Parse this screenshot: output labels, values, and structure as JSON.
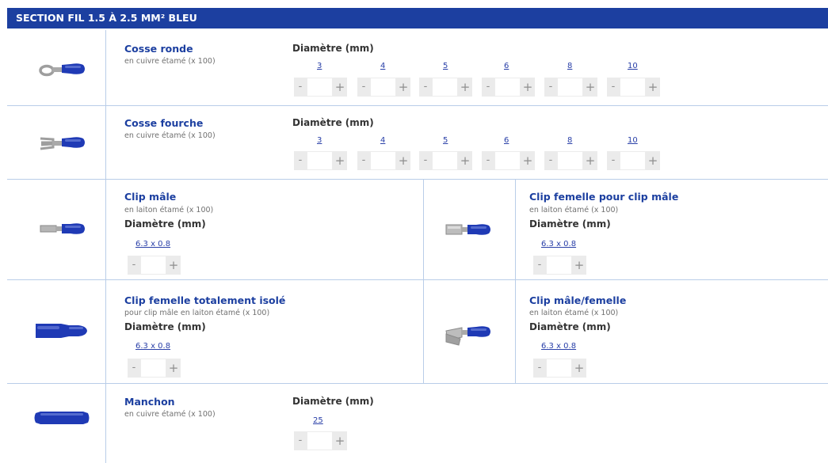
{
  "header": {
    "title": "SECTION FIL 1.5 À 2.5 MM² BLEU"
  },
  "diameter_label": "Diamètre (mm)",
  "stepper": {
    "minus": "-",
    "plus": "+"
  },
  "products": {
    "cosse_ronde": {
      "title": "Cosse ronde",
      "subtitle": "en cuivre étamé (x 100)",
      "sizes": [
        "3",
        "4",
        "5",
        "6",
        "8",
        "10"
      ]
    },
    "cosse_fourche": {
      "title": "Cosse fourche",
      "subtitle": "en cuivre étamé (x 100)",
      "sizes": [
        "3",
        "4",
        "5",
        "6",
        "8",
        "10"
      ]
    },
    "clip_male": {
      "title": "Clip mâle",
      "subtitle": "en laiton étamé (x 100)",
      "sizes": [
        "6.3 x 0.8"
      ]
    },
    "clip_femelle": {
      "title": "Clip femelle pour clip mâle",
      "subtitle": "en laiton étamé (x 100)",
      "sizes": [
        "6.3 x 0.8"
      ]
    },
    "clip_femelle_isole": {
      "title": "Clip femelle totalement isolé",
      "subtitle": "pour clip mâle en laiton étamé (x 100)",
      "sizes": [
        "6.3 x 0.8"
      ]
    },
    "clip_male_femelle": {
      "title": "Clip mâle/femelle",
      "subtitle": "en laiton étamé (x 100)",
      "sizes": [
        "6.3 x 0.8"
      ]
    },
    "manchon": {
      "title": "Manchon",
      "subtitle": "en cuivre étamé (x 100)",
      "sizes": [
        "25"
      ]
    }
  },
  "colors": {
    "header_bg": "#1c3fa0",
    "title": "#1c3fa0",
    "link": "#2a40a8",
    "insulator_blue": "#1f3ab5"
  }
}
